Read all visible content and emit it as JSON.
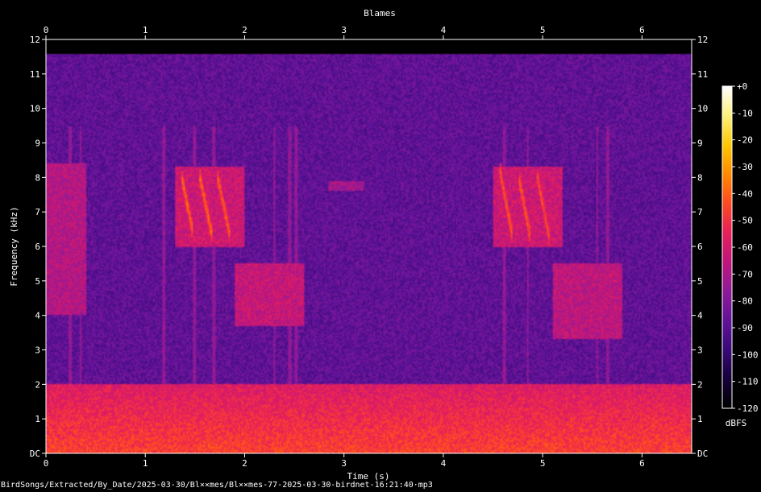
{
  "chart_data": {
    "type": "heatmap",
    "title": "Blames",
    "xlabel": "Time (s)",
    "ylabel": "Frequency (kHz)",
    "xlim": [
      0,
      6.5
    ],
    "ylim": [
      0,
      12
    ],
    "x_ticks": [
      0,
      1,
      2,
      3,
      4,
      5,
      6
    ],
    "y_ticks": [
      {
        "value": 0,
        "label": "DC"
      },
      {
        "value": 1,
        "label": "1"
      },
      {
        "value": 2,
        "label": "2"
      },
      {
        "value": 3,
        "label": "3"
      },
      {
        "value": 4,
        "label": "4"
      },
      {
        "value": 5,
        "label": "5"
      },
      {
        "value": 6,
        "label": "6"
      },
      {
        "value": 7,
        "label": "7"
      },
      {
        "value": 8,
        "label": "8"
      },
      {
        "value": 9,
        "label": "9"
      },
      {
        "value": 10,
        "label": "10"
      },
      {
        "value": 11,
        "label": "11"
      },
      {
        "value": 12,
        "label": "12"
      }
    ],
    "colorbar": {
      "label": "dBFS",
      "range": [
        -120,
        0
      ],
      "ticks": [
        {
          "value": 0,
          "label": "+0"
        },
        {
          "value": -10,
          "label": "-10"
        },
        {
          "value": -20,
          "label": "-20"
        },
        {
          "value": -30,
          "label": "-30"
        },
        {
          "value": -40,
          "label": "-40"
        },
        {
          "value": -50,
          "label": "-50"
        },
        {
          "value": -60,
          "label": "-60"
        },
        {
          "value": -70,
          "label": "-70"
        },
        {
          "value": -80,
          "label": "-80"
        },
        {
          "value": -90,
          "label": "-90"
        },
        {
          "value": -100,
          "label": "-100"
        },
        {
          "value": -110,
          "label": "-110"
        },
        {
          "value": -120,
          "label": "-120"
        }
      ],
      "colors": [
        "#000000",
        "#16003a",
        "#3a0a78",
        "#62139a",
        "#8f1b98",
        "#c0167c",
        "#e8205a",
        "#ff4a22",
        "#ff8a00",
        "#ffc800",
        "#fff07a",
        "#ffffff"
      ]
    },
    "grid": false,
    "background_level_db": -88,
    "low_band": {
      "f_max": 2.0,
      "level_db": -58
    },
    "spectral_ceiling_khz": 11.6,
    "calls": [
      {
        "t_start": 1.36,
        "t_end": 1.48,
        "f_start": 8.1,
        "f_end": 6.4,
        "level_db": -38
      },
      {
        "t_start": 1.55,
        "t_end": 1.68,
        "f_start": 8.0,
        "f_end": 6.2,
        "level_db": -38
      },
      {
        "t_start": 1.72,
        "t_end": 1.86,
        "f_start": 8.1,
        "f_end": 6.2,
        "level_db": -40
      },
      {
        "t_start": 4.57,
        "t_end": 4.69,
        "f_start": 8.2,
        "f_end": 6.4,
        "level_db": -40
      },
      {
        "t_start": 4.76,
        "t_end": 4.88,
        "f_start": 8.0,
        "f_end": 6.2,
        "level_db": -40
      },
      {
        "t_start": 4.94,
        "t_end": 5.07,
        "f_start": 8.1,
        "f_end": 6.2,
        "level_db": -42
      }
    ],
    "energy_regions": [
      {
        "t": [
          0.0,
          0.4
        ],
        "f": [
          4.0,
          8.4
        ],
        "level_db": -68
      },
      {
        "t": [
          1.3,
          2.0
        ],
        "f": [
          6.0,
          8.3
        ],
        "level_db": -62
      },
      {
        "t": [
          1.9,
          2.6
        ],
        "f": [
          3.7,
          5.5
        ],
        "level_db": -64
      },
      {
        "t": [
          4.5,
          5.2
        ],
        "f": [
          6.0,
          8.3
        ],
        "level_db": -62
      },
      {
        "t": [
          5.1,
          5.8
        ],
        "f": [
          3.3,
          5.5
        ],
        "level_db": -66
      },
      {
        "t": [
          2.85,
          3.2
        ],
        "f": [
          7.6,
          7.9
        ],
        "level_db": -72
      }
    ],
    "vertical_clicks": [
      0.25,
      0.35,
      1.18,
      1.5,
      1.69,
      2.3,
      2.45,
      2.52,
      4.62,
      4.85,
      5.55,
      5.65
    ]
  },
  "footer": "BirdSongs/Extracted/By_Date/2025-03-30/Bl××mes/Bl××mes-77-2025-03-30-birdnet-16:21:40·mp3"
}
